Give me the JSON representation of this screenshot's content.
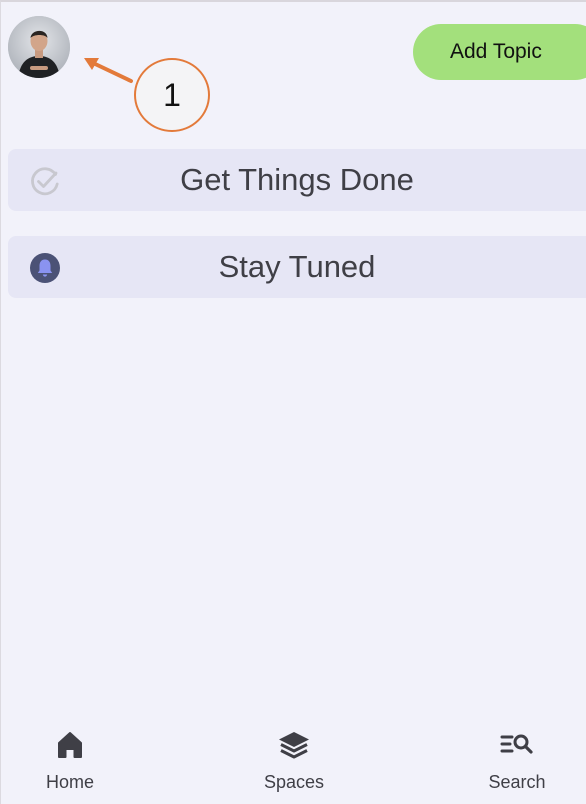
{
  "header": {
    "avatar_icon": "user-profile-photo",
    "add_topic_label": "Add Topic"
  },
  "annotation": {
    "number": "1",
    "color": "#e37a3a"
  },
  "topics": [
    {
      "label": "Get Things Done",
      "icon": "check-circle-icon",
      "icon_color": "#c8c8cf"
    },
    {
      "label": "Stay Tuned",
      "icon": "bell-icon",
      "icon_color": "#4b5276"
    }
  ],
  "bottom_nav": [
    {
      "label": "Home",
      "icon": "home-icon"
    },
    {
      "label": "Spaces",
      "icon": "layers-icon"
    },
    {
      "label": "Search",
      "icon": "search-list-icon"
    }
  ],
  "colors": {
    "background": "#f2f2fa",
    "topic_background": "#e6e6f5",
    "add_topic_button": "#a3e07c",
    "text": "#3f3f46"
  }
}
